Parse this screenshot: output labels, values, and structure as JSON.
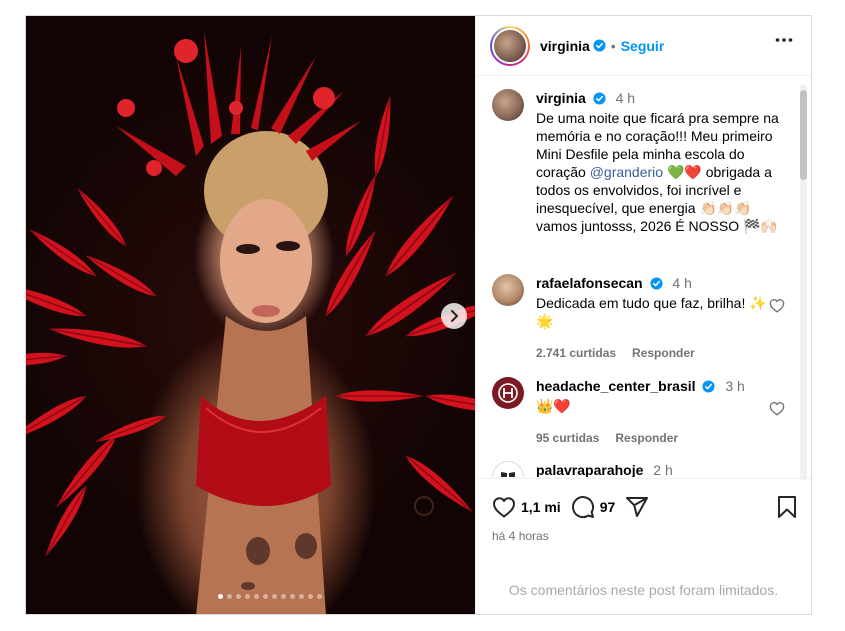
{
  "post": {
    "author": "virginia",
    "follow_label": "Seguir",
    "separator": "•"
  },
  "caption": {
    "author": "virginia",
    "time": "4 h",
    "text_before": "De uma noite que ficará pra sempre na memória e no coração!!! Meu primeiro Mini Desfile pela minha escola do coração ",
    "mention": "@granderio",
    "text_after": " 💚❤️ obrigada a todos os envolvidos, foi incrível e inesquecível, que energia 👏🏻👏🏻👏🏻 vamos juntosss, 2026 É NOSSO 🏁🙌🏻"
  },
  "comments": [
    {
      "user": "rafaelafonsecan",
      "verified": true,
      "time": "4 h",
      "text": "Dedicada em tudo que faz, brilha! ✨🌟",
      "likes": "2.741 curtidas",
      "reply": "Responder"
    },
    {
      "user": "headache_center_brasil",
      "verified": true,
      "time": "3 h",
      "text": "👑❤️",
      "likes": "95 curtidas",
      "reply": "Responder"
    },
    {
      "user": "palavraparahoje",
      "verified": false,
      "time": "2 h",
      "text": ""
    }
  ],
  "actions": {
    "likes_count": "1,1 mi",
    "comments_count": "97",
    "posted_ago": "há 4 horas",
    "comments_limited": "Os comentários neste post foram limitados."
  },
  "carousel": {
    "total": 12,
    "active": 0
  },
  "colors": {
    "accent": "#0095f6",
    "verified": "#0095f6",
    "mention": "#3d5e97",
    "costume_red": "#d4121e"
  },
  "icons": [
    "verified-icon",
    "more-icon",
    "heart-icon",
    "comment-icon",
    "share-icon",
    "bookmark-icon",
    "chevron-right-icon"
  ]
}
